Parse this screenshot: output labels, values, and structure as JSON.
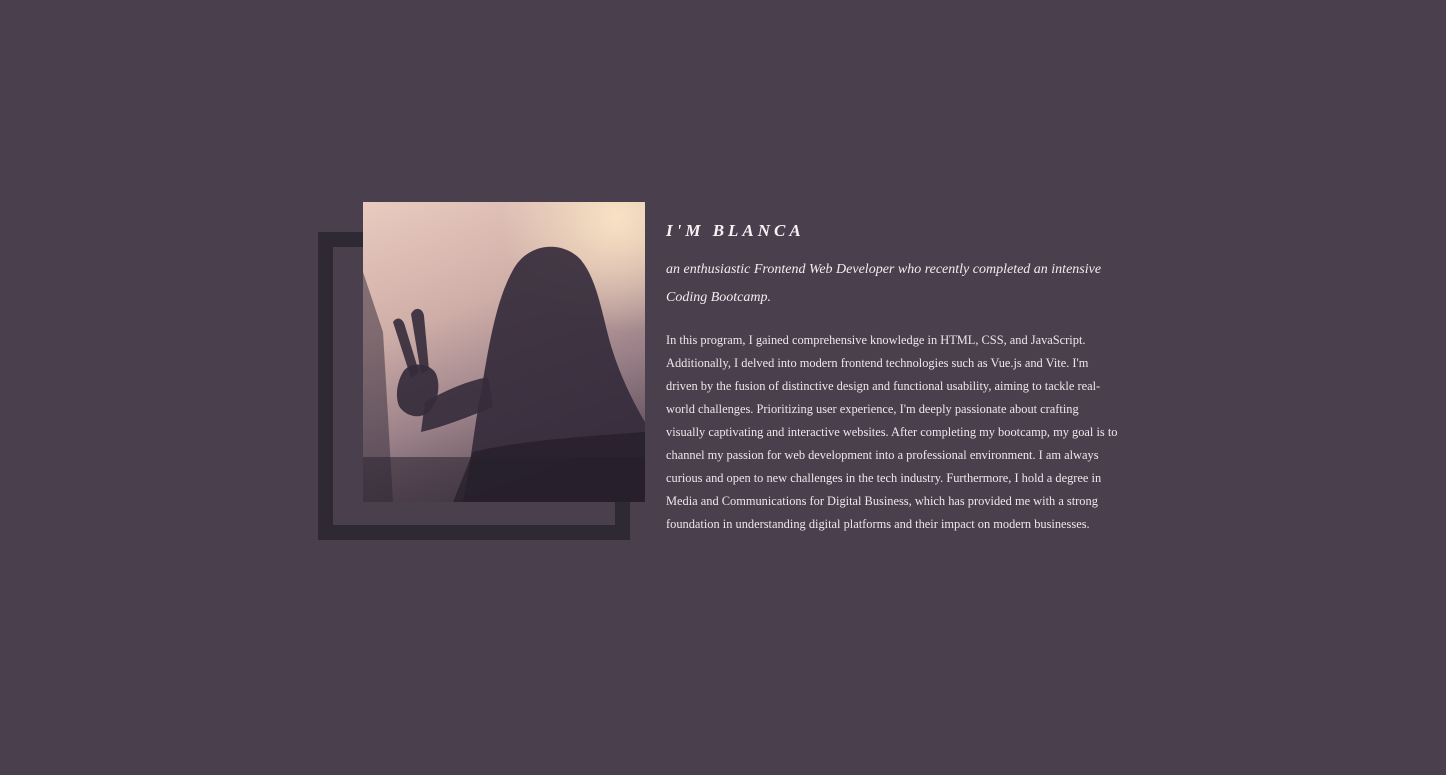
{
  "about": {
    "heading": "I'M BLANCA",
    "subtitle": "an enthusiastic Frontend Web Developer who recently completed an intensive Coding Bootcamp.",
    "bio": "In this program, I gained comprehensive knowledge in HTML, CSS, and JavaScript. Additionally, I delved into modern frontend technologies such as Vue.js and Vite. I'm driven by the fusion of distinctive design and functional usability, aiming to tackle real-world challenges. Prioritizing user experience, I'm deeply passionate about crafting visually captivating and interactive websites. After completing my bootcamp, my goal is to channel my passion for web development into a professional environment. I am always curious and open to new challenges in the tech industry. Furthermore, I hold a degree in Media and Communications for Digital Business, which has provided me with a strong foundation in understanding digital platforms and their impact on modern businesses.",
    "photo": {
      "depicts": "shadow silhouette of a person making a peace sign on a wall"
    }
  },
  "colors": {
    "background": "#4a3f4d",
    "frame": "#2f2933",
    "text": "#f3ecef"
  }
}
